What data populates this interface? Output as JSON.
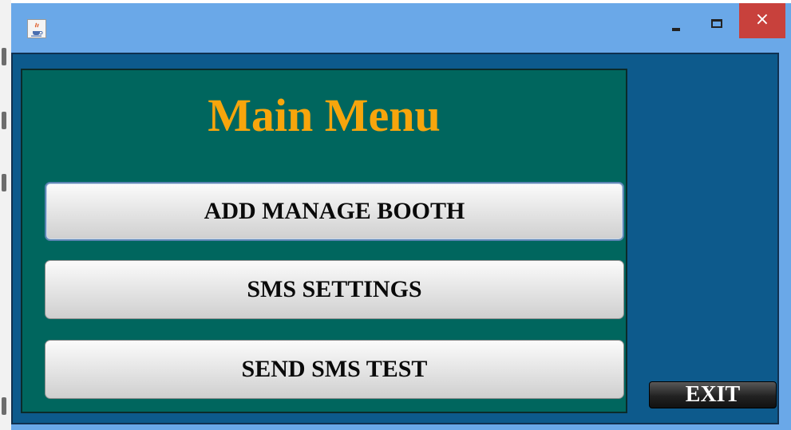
{
  "window": {
    "app_icon": "java-cup-icon",
    "controls": {
      "minimize_icon": "minimize-icon",
      "maximize_icon": "maximize-icon",
      "close_label": "×"
    }
  },
  "main": {
    "title": "Main Menu",
    "buttons": [
      {
        "label": "ADD MANAGE BOOTH"
      },
      {
        "label": "SMS SETTINGS"
      },
      {
        "label": "SEND SMS TEST"
      }
    ],
    "exit_label": "EXIT"
  },
  "colors": {
    "title_bar": "#6aa8e8",
    "content_bg": "#0d5a8c",
    "panel_bg": "#00665e",
    "title_text": "#f7a50c",
    "close_button": "#c8413c"
  }
}
